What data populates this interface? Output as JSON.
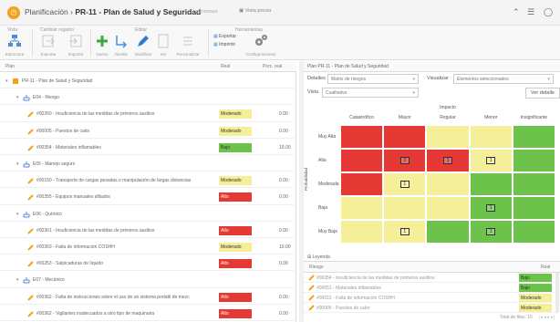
{
  "titlebar": {
    "app_name": "Planificación",
    "separator": "›",
    "project": "PR-11 - Plan de Salud y Seguridad",
    "extra1": "versiones",
    "extra2": "Vista previa",
    "controls": [
      "⌃",
      "☰",
      "◯"
    ]
  },
  "ribbon": {
    "groups": [
      {
        "title": "Vista",
        "buttons": [
          "Estructura"
        ]
      },
      {
        "title": "Cambiar registro",
        "buttons": [
          "Exportar",
          "Importar"
        ]
      },
      {
        "title": "Editar",
        "buttons": [
          "Nuevo",
          "Nivelar",
          "Modificar",
          "Ver",
          "Personalizar"
        ]
      },
      {
        "title": "Herramientas",
        "buttons": [
          "Exportar",
          "Imprimir",
          "Configuraciones"
        ]
      }
    ]
  },
  "left": {
    "columns": {
      "name": "Plan",
      "risk": "Real",
      "pct": "Porc. real"
    },
    "rows": [
      {
        "type": "root",
        "label": "PR-11 - Plan de Salud y Seguridad",
        "indent": 0
      },
      {
        "type": "folder",
        "label": "E04 - Riesgo",
        "indent": 1
      },
      {
        "type": "task",
        "label": "#00350 - Insuficiencia de las medidas de primeros auxilios",
        "risk": "Moderado",
        "color": "#f5ef9a",
        "pct": "0.00",
        "indent": 2
      },
      {
        "type": "task",
        "label": "#00005 - Puestos de calor",
        "risk": "Moderado",
        "color": "#f5ef9a",
        "pct": "0.00",
        "indent": 2
      },
      {
        "type": "task",
        "label": "#00354 - Materiales inflamables",
        "risk": "Bajo",
        "color": "#6cc24a",
        "pct": "10.00",
        "indent": 2
      },
      {
        "type": "folder",
        "label": "E05 - Manejo seguro",
        "indent": 1
      },
      {
        "type": "task",
        "label": "#00150 - Transporte de cargas pesadas o manipulación de largas distancias",
        "risk": "Moderado",
        "color": "#f5ef9a",
        "pct": "0.00",
        "indent": 2
      },
      {
        "type": "task",
        "label": "#00355 - Equipos manuales afilados",
        "risk": "Alto",
        "color": "#e53935",
        "pct": "0.00",
        "indent": 2
      },
      {
        "type": "folder",
        "label": "E06 - Químico",
        "indent": 1
      },
      {
        "type": "task",
        "label": "#00361 - Insuficiencia de las medidas de primeros auxilios",
        "risk": "Alto",
        "color": "#e53935",
        "pct": "0.00",
        "indent": 2
      },
      {
        "type": "task",
        "label": "#00363 - Falta de información COSHH",
        "risk": "Moderado",
        "color": "#f5ef9a",
        "pct": "10.00",
        "indent": 2
      },
      {
        "type": "task",
        "label": "#00253 - Salpicaduras de líquido",
        "risk": "Alto",
        "color": "#e53935",
        "pct": "0.00",
        "indent": 2
      },
      {
        "type": "folder",
        "label": "E07 - Mecánico",
        "indent": 1
      },
      {
        "type": "task",
        "label": "#00362 - Falta de instrucciones sobre el uso de un sistema portátil de mezc",
        "risk": "Alto",
        "color": "#e53935",
        "pct": "0.00",
        "indent": 2
      },
      {
        "type": "task",
        "label": "#00362 - Vigilantes inadecuados a otro tipo de maquinaria",
        "risk": "Alto",
        "color": "#e53935",
        "pct": "0.00",
        "indent": 2
      }
    ]
  },
  "right": {
    "title": "Plan PR-11 - Plan de Salud y Seguridad",
    "detalles_label": "Detalles",
    "detalles_value": "Matriz de riesgos",
    "visualizar_label": "Visualizar",
    "visualizar_value": "Elementos seleccionados",
    "vista_label": "Vista",
    "vista_value": "Cualitativo",
    "ver_detalle": "Ver detalle",
    "matrix": {
      "impact_title": "Impacto",
      "likelihood_title": "Probabilidad",
      "columns": [
        "Catastrófico",
        "Mayor",
        "Regular",
        "Menor",
        "Insignificante"
      ],
      "rows": [
        "Muy Alta",
        "Alta",
        "Moderada",
        "Baja",
        "Muy Baja"
      ],
      "colors": [
        [
          "#e53935",
          "#e53935",
          "#f5ef9a",
          "#f5ef9a",
          "#6cc24a"
        ],
        [
          "#e53935",
          "#e53935",
          "#e53935",
          "#f5ef9a",
          "#6cc24a"
        ],
        [
          "#e53935",
          "#f5ef9a",
          "#f5ef9a",
          "#6cc24a",
          "#6cc24a"
        ],
        [
          "#f5ef9a",
          "#f5ef9a",
          "#f5ef9a",
          "#6cc24a",
          "#6cc24a"
        ],
        [
          "#f5ef9a",
          "#f5ef9a",
          "#6cc24a",
          "#6cc24a",
          "#6cc24a"
        ]
      ],
      "badges": [
        {
          "row": 1,
          "col": 1,
          "text": "2"
        },
        {
          "row": 1,
          "col": 2,
          "text": "1"
        },
        {
          "row": 1,
          "col": 3,
          "text": "1"
        },
        {
          "row": 2,
          "col": 1,
          "text": "1"
        },
        {
          "row": 3,
          "col": 3,
          "text": "1"
        },
        {
          "row": 4,
          "col": 1,
          "text": "1"
        },
        {
          "row": 4,
          "col": 3,
          "text": "1"
        }
      ]
    },
    "legend_label": "Leyenda",
    "list": {
      "col_name": "Riesgo",
      "col_real": "Real",
      "rows": [
        {
          "label": "#00354 - Insuficiencia de las medidas de primeros auxilios",
          "risk": "Bajo",
          "color": "#6cc24a"
        },
        {
          "label": "#00051 - Materiales inflamables",
          "risk": "Bajo",
          "color": "#6cc24a"
        },
        {
          "label": "#00015 - Falta de información COSHH",
          "risk": "Moderado",
          "color": "#f5ef9a"
        },
        {
          "label": "#00005 - Puestos de calor",
          "risk": "Moderado",
          "color": "#f5ef9a"
        }
      ],
      "footer": "Total de filas: 15"
    }
  }
}
